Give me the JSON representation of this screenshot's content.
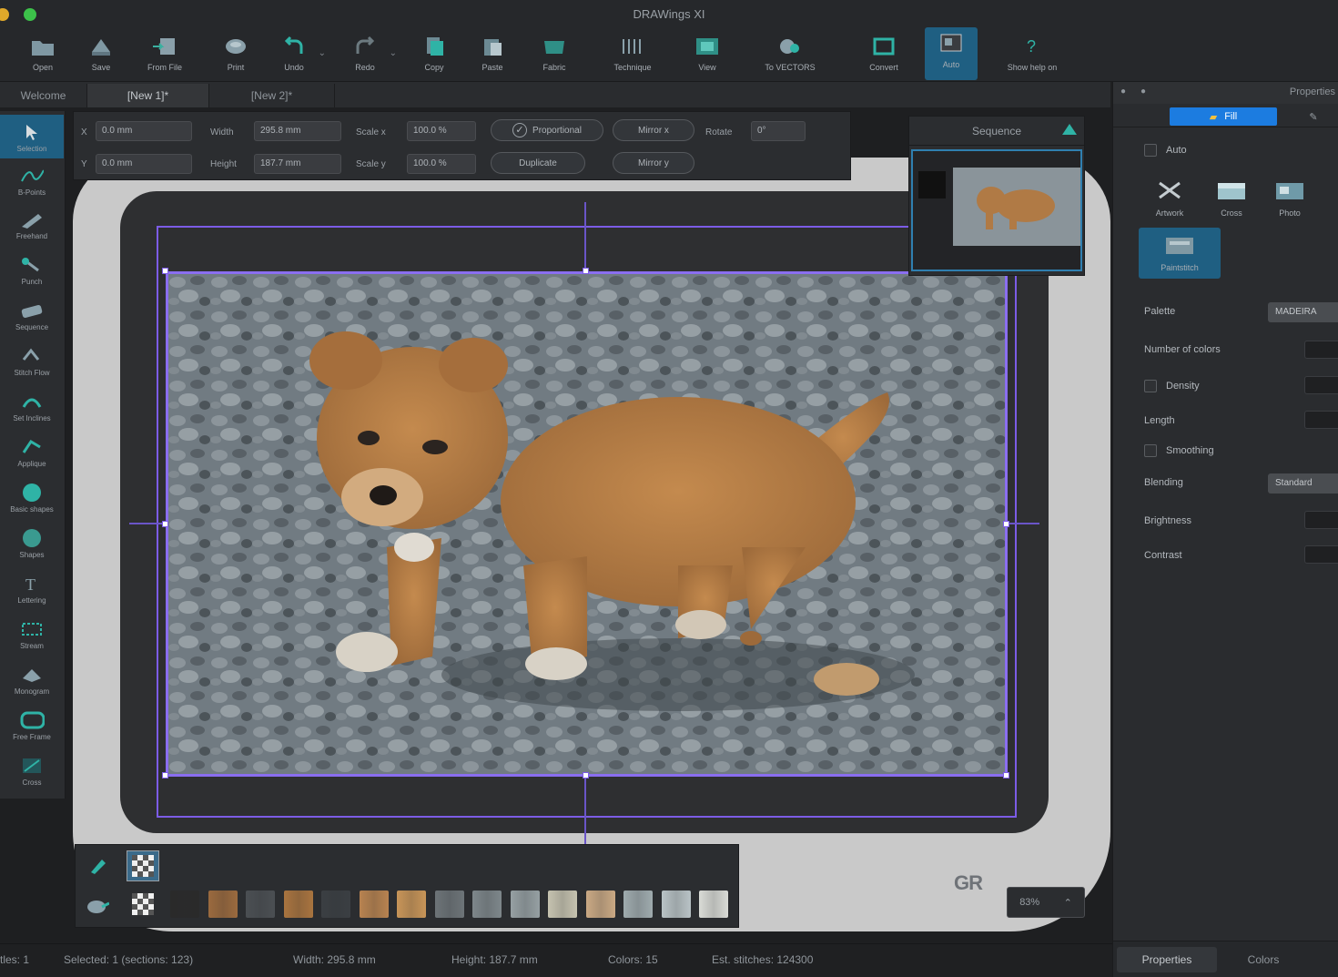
{
  "app": {
    "title": "DRAWings XI"
  },
  "colors": {
    "accent": "#1f5f82",
    "frame": "#7c5ce6",
    "fill_tab": "#1c7ce0"
  },
  "toolbar": [
    {
      "label": "Open",
      "icon": "folder-icon"
    },
    {
      "label": "Save",
      "icon": "save-icon"
    },
    {
      "label": "From File",
      "icon": "import-icon"
    },
    {
      "label": "Print",
      "icon": "print-icon"
    },
    {
      "label": "Undo",
      "icon": "undo-icon"
    },
    {
      "label": "Redo",
      "icon": "redo-icon"
    },
    {
      "label": "Copy",
      "icon": "copy-icon"
    },
    {
      "label": "Paste",
      "icon": "paste-icon"
    },
    {
      "label": "Fabric",
      "icon": "fabric-icon"
    },
    {
      "label": "Technique",
      "icon": "technique-icon"
    },
    {
      "label": "View",
      "icon": "view-icon"
    },
    {
      "label": "To VECTORS",
      "icon": "vectors-icon"
    },
    {
      "label": "Convert",
      "icon": "convert-icon"
    },
    {
      "label": "Auto",
      "icon": "auto-icon"
    },
    {
      "label": "Show help on",
      "icon": "help-icon"
    }
  ],
  "tabs": [
    "Welcome",
    "[New 1]*",
    "[New 2]*"
  ],
  "palette": [
    {
      "label": "Selection",
      "icon": "selection-arrow-icon"
    },
    {
      "label": "B-Points",
      "icon": "bezier-icon"
    },
    {
      "label": "Freehand",
      "icon": "freehand-icon"
    },
    {
      "label": "Punch",
      "icon": "punch-icon"
    },
    {
      "label": "Sequence",
      "icon": "sequence-icon"
    },
    {
      "label": "Stitch Flow",
      "icon": "stitch-flow-icon"
    },
    {
      "label": "Set Inclines",
      "icon": "inclines-icon"
    },
    {
      "label": "Applique",
      "icon": "applique-icon"
    },
    {
      "label": "Basic shapes",
      "icon": "shapes-icon"
    },
    {
      "label": "Shapes",
      "icon": "shapes2-icon"
    },
    {
      "label": "Lettering",
      "icon": "lettering-icon"
    },
    {
      "label": "Stream",
      "icon": "stream-icon"
    },
    {
      "label": "Monogram",
      "icon": "monogram-icon"
    },
    {
      "label": "Free Frame",
      "icon": "frame-icon"
    },
    {
      "label": "Cross",
      "icon": "cross-icon"
    }
  ],
  "propbar": {
    "x_label": "X",
    "x_value": "0.0 mm",
    "y_label": "Y",
    "y_value": "0.0 mm",
    "width_label": "Width",
    "width_value": "295.8 mm",
    "height_label": "Height",
    "height_value": "187.7 mm",
    "scalex_label": "Scale x",
    "scalex_value": "100.0 %",
    "scaley_label": "Scale y",
    "scaley_value": "100.0 %",
    "proportional": "Proportional",
    "duplicate": "Duplicate",
    "mirror_x": "Mirror x",
    "mirror_y": "Mirror y",
    "rotate_label": "Rotate",
    "rotate_value": "0°"
  },
  "sequence": {
    "title": "Sequence"
  },
  "rpanel": {
    "title": "Properties",
    "tab_fill": "Fill",
    "auto_label": "Auto",
    "modes": [
      {
        "label": "Artwork",
        "icon": "artwork-icon"
      },
      {
        "label": "Cross",
        "icon": "cross-stitch-icon"
      },
      {
        "label": "Photo",
        "icon": "photo-icon"
      },
      {
        "label": "Paintstitch",
        "icon": "paintstitch-icon"
      }
    ],
    "rows": [
      {
        "label": "Palette",
        "value": "MADEIRA"
      },
      {
        "label": "Number of colors",
        "value": ""
      },
      {
        "label": "Density",
        "value": ""
      },
      {
        "label": "Length",
        "value": ""
      },
      {
        "label": "Smoothing",
        "value": ""
      },
      {
        "label": "Blending",
        "value": "Standard"
      },
      {
        "label": "Brightness",
        "value": ""
      },
      {
        "label": "Contrast",
        "value": ""
      }
    ],
    "bottom_tabs": [
      "Properties",
      "Colors"
    ]
  },
  "colorbar": {
    "swatches": [
      "#2a2a2a",
      "#9b6a3e",
      "#4b4f53",
      "#a9743f",
      "#3b3f43",
      "#b88350",
      "#c89558",
      "#6d7478",
      "#7e878b",
      "#96a0a3",
      "#c6c3b0",
      "#caa984",
      "#9fabae",
      "#b9c3c6",
      "#d9dbd6"
    ]
  },
  "zoom": {
    "value": "83%"
  },
  "watermark": "GR",
  "status": {
    "items": "tles: 1",
    "selected": "Selected: 1 (sections: 123)",
    "width": "Width: 295.8 mm",
    "height": "Height: 187.7 mm",
    "colors": "Colors: 15",
    "stitches": "Est. stitches: 124300"
  }
}
